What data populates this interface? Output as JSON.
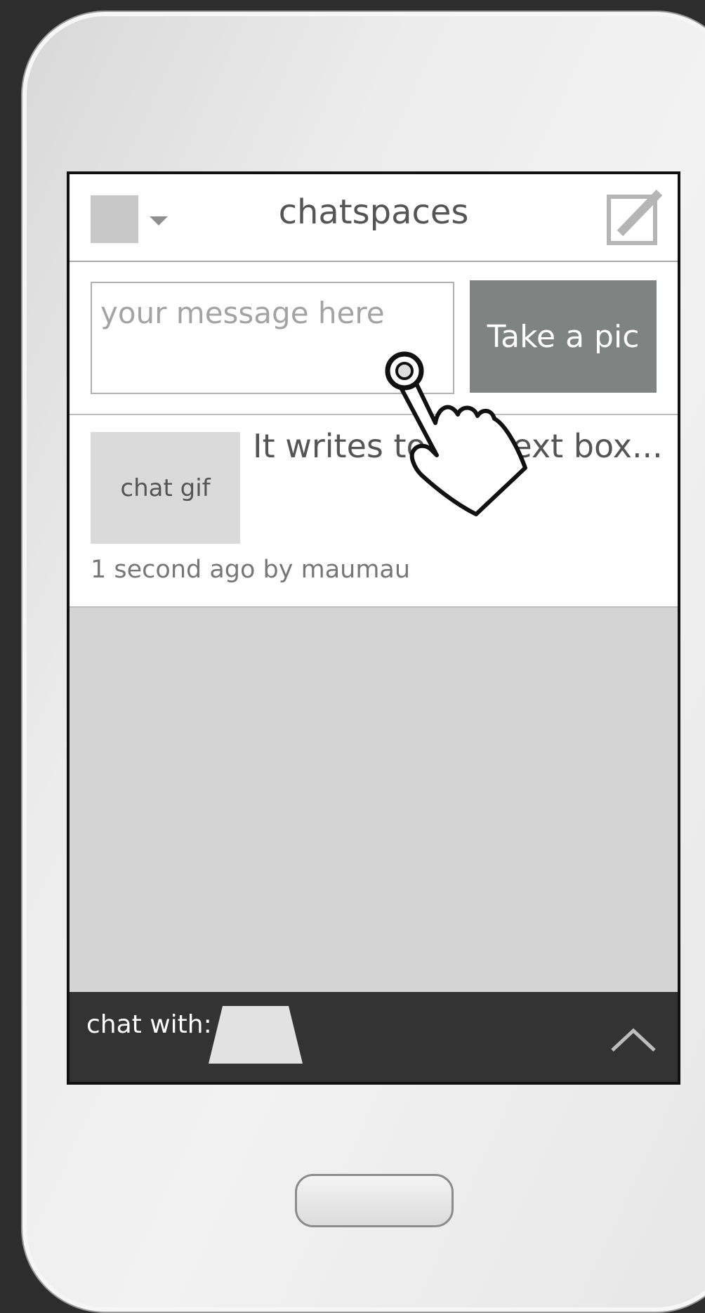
{
  "header": {
    "title": "chatspaces"
  },
  "composer": {
    "placeholder": "your message here",
    "pic_button_label": "Take a pic"
  },
  "post": {
    "media_label": "chat gif",
    "text": "It writes to the text box...",
    "meta": "1 second ago by maumau"
  },
  "footer": {
    "chat_with_label": "chat with:"
  },
  "icons": {
    "avatar": "avatar-placeholder",
    "dropdown": "caret-down-icon",
    "compose": "compose-icon",
    "pointer": "hand-pointer-icon",
    "expand": "chevron-up-icon",
    "contact": "contact-shape-icon"
  },
  "colors": {
    "background": "#2d2d2d",
    "screen_bg": "#d4d4d4",
    "button_bg": "#7f8381",
    "footer_bg": "#333333"
  }
}
